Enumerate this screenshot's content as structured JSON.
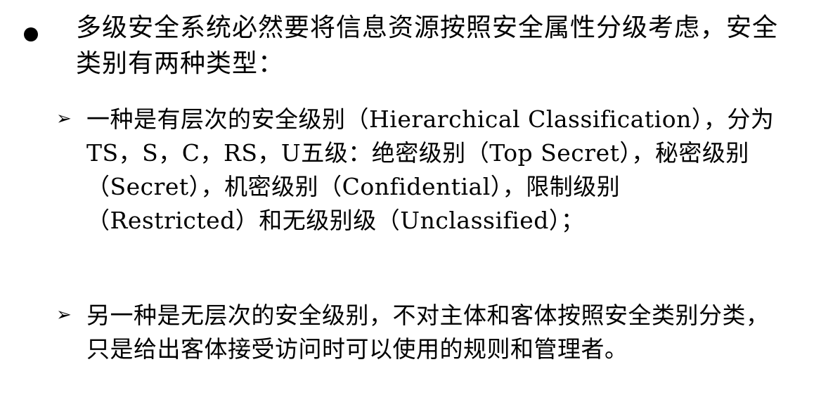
{
  "main_bullet": {
    "text": "多级安全系统必然要将信息资源按照安全属性分级考虑，安全类别有两种类型："
  },
  "sub_bullets": [
    {
      "marker": "➢",
      "text": "一种是有层次的安全级别（Hierarchical Classification），分为TS，S，C，RS，U五级：绝密级别（Top Secret），秘密级别（Secret），机密级别（Confidential），限制级别（Restricted）和无级别级（Unclassified）；"
    },
    {
      "marker": "➢",
      "text": "另一种是无层次的安全级别，不对主体和客体按照安全类别分类，只是给出客体接受访问时可以使用的规则和管理者。"
    }
  ]
}
